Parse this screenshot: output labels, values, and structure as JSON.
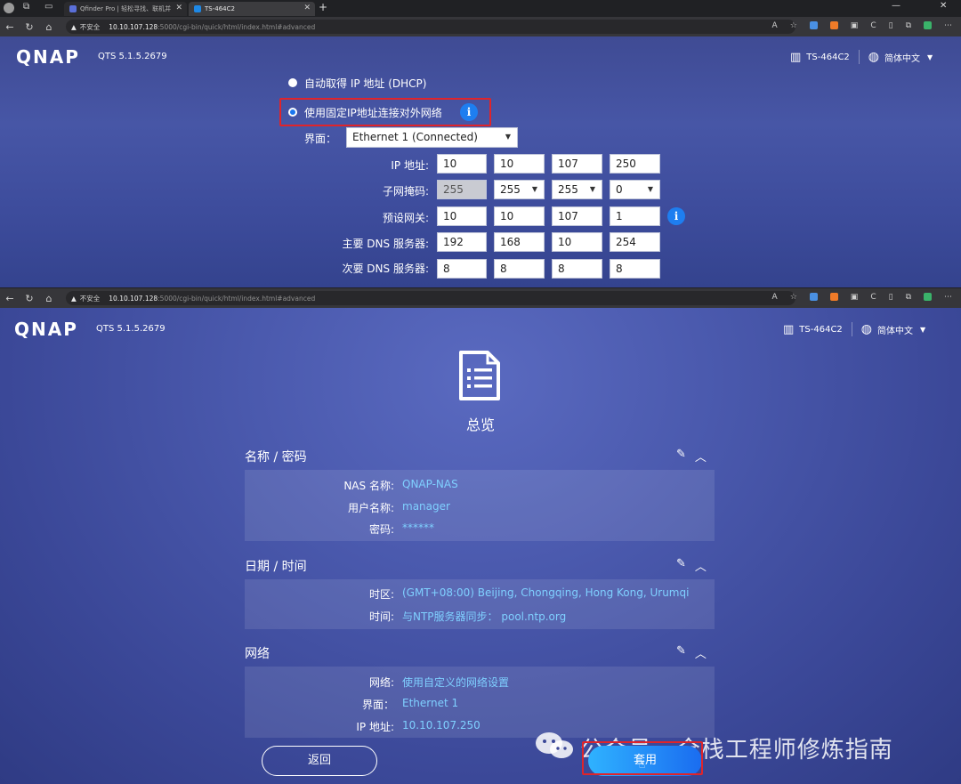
{
  "browser": {
    "tab1_title": "Qfinder Pro | 轻松寻找、联机并",
    "tab2_title": "TS-464C2",
    "not_secure": "不安全",
    "url_host": "10.10.107.128",
    "url_path": ":5000/cgi-bin/quick/html/index.html#advanced"
  },
  "qnap": {
    "logo": "QNAP",
    "version": "QTS 5.1.5.2679",
    "device": "TS-464C2",
    "language": "简体中文"
  },
  "network_form": {
    "dhcp_label": "自动取得 IP 地址 (DHCP)",
    "static_label": "使用固定IP地址连接对外网络",
    "interface_label": "界面：",
    "interface_value": "Ethernet 1 (Connected)",
    "ip_label": "IP 地址:",
    "ip": [
      "10",
      "10",
      "107",
      "250"
    ],
    "mask_label": "子网掩码:",
    "mask": [
      "255",
      "255",
      "255",
      "0"
    ],
    "gateway_label": "预设网关:",
    "gateway": [
      "10",
      "10",
      "107",
      "1"
    ],
    "dns1_label": "主要 DNS 服务器:",
    "dns1": [
      "192",
      "168",
      "10",
      "254"
    ],
    "dns2_label": "次要 DNS 服务器:",
    "dns2": [
      "8",
      "8",
      "8",
      "8"
    ]
  },
  "summary": {
    "title": "总览",
    "name_section": {
      "title": "名称 / 密码",
      "nas_name_label": "NAS 名称:",
      "nas_name": "QNAP-NAS",
      "user_label": "用户名称:",
      "user": "manager",
      "password_label": "密码:",
      "password": "******"
    },
    "date_section": {
      "title": "日期 / 时间",
      "tz_label": "时区:",
      "tz": "(GMT+08:00) Beijing, Chongqing, Hong Kong, Urumqi",
      "time_label": "时间:",
      "time": "与NTP服务器同步： pool.ntp.org"
    },
    "net_section": {
      "title": "网络",
      "net_label": "网络:",
      "net": "使用自定义的网络设置",
      "iface_label": "界面：",
      "iface": "Ethernet 1",
      "ip_label": "IP 地址:",
      "ip": "10.10.107.250"
    },
    "back_label": "返回",
    "apply_label": "套用"
  },
  "watermark": "公众号 · 全栈工程师修炼指南",
  "colors": {
    "accent": "#1e7ef0",
    "highlight_box": "#e0242a",
    "value_text": "#7fd0ff"
  }
}
